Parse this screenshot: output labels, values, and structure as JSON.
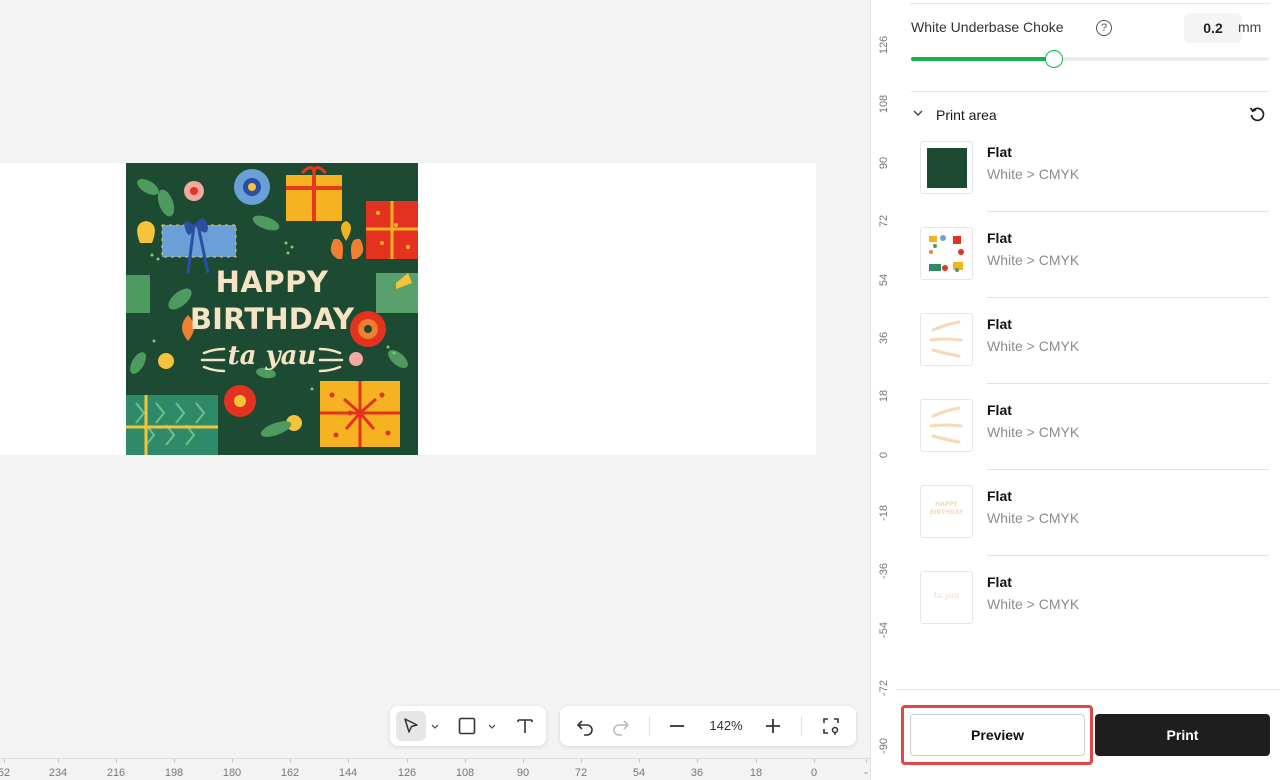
{
  "canvas": {
    "design": {
      "line1": "HAPPY",
      "line2": "BIRTHDAY",
      "line3": "ta yau",
      "background_color": "#1c4a33",
      "text_color": "#f6e4c4"
    },
    "ruler_bottom": [
      "52",
      "234",
      "216",
      "198",
      "180",
      "162",
      "144",
      "126",
      "108",
      "90",
      "72",
      "54",
      "36",
      "18",
      "0",
      "-"
    ],
    "ruler_right": [
      "126",
      "108",
      "90",
      "72",
      "54",
      "36",
      "18",
      "0",
      "-18",
      "-36",
      "-54",
      "-72",
      "-90"
    ]
  },
  "toolbar": {
    "zoom": "142%",
    "icons": [
      "select-arrow-icon",
      "chevron-down-icon",
      "rectangle-icon",
      "chevron-down-icon",
      "text-icon",
      "undo-icon",
      "redo-icon",
      "zoom-out-icon",
      "zoom-in-icon",
      "fit-screen-icon"
    ]
  },
  "panel": {
    "choke": {
      "label": "White Underbase Choke",
      "help": "?",
      "value": "0.2",
      "unit": "mm",
      "slider_fraction": 0.4
    },
    "print_area": {
      "title": "Print area",
      "layers": [
        {
          "name": "Flat",
          "mode": "White > CMYK",
          "thumb": "solid-green"
        },
        {
          "name": "Flat",
          "mode": "White > CMYK",
          "thumb": "full-artwork"
        },
        {
          "name": "Flat",
          "mode": "White > CMYK",
          "thumb": "swoosh-strokes"
        },
        {
          "name": "Flat",
          "mode": "White > CMYK",
          "thumb": "swoosh-strokes"
        },
        {
          "name": "Flat",
          "mode": "White > CMYK",
          "thumb": "text-happy-birthday",
          "thumb_text": [
            "HAPPY",
            "BIRTHDAY"
          ]
        },
        {
          "name": "Flat",
          "mode": "White > CMYK",
          "thumb": "text-script",
          "thumb_text": [
            "ta yau"
          ]
        }
      ]
    },
    "buttons": {
      "preview": "Preview",
      "print": "Print"
    },
    "colors": {
      "accent_green": "#15b34b",
      "highlight_red": "#e64545",
      "print_button": "#1e1e1e"
    }
  }
}
